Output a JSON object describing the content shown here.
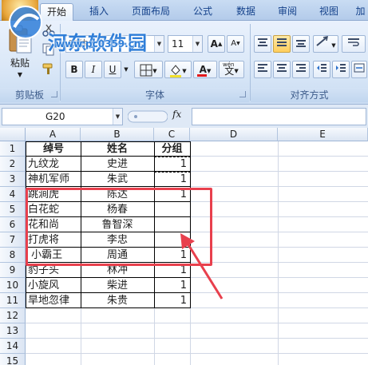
{
  "ribbon": {
    "tabs": [
      {
        "label": "开始"
      },
      {
        "label": "插入"
      },
      {
        "label": "页面布局"
      },
      {
        "label": "公式"
      },
      {
        "label": "数据"
      },
      {
        "label": "审阅"
      },
      {
        "label": "视图"
      },
      {
        "label": "加"
      }
    ],
    "watermark": {
      "title": "河东软件园",
      "url": "www.pc0359.cn"
    },
    "clipboard": {
      "paste_label": "粘贴",
      "group_label": "剪贴板"
    },
    "font": {
      "name": "宋体",
      "size": "11",
      "grow_label": "A",
      "shrink_label": "A",
      "bold": "B",
      "italic": "I",
      "underline": "U",
      "font_color_letter": "A",
      "wen_label": "文",
      "group_label": "字体",
      "fill_color": "#f2e02c",
      "font_color": "#e31a1c"
    },
    "alignment": {
      "group_label": "对齐方式"
    }
  },
  "formula_bar": {
    "name_box": "G20",
    "fx_label": "fx",
    "formula": ""
  },
  "sheet": {
    "columns": [
      "A",
      "B",
      "C",
      "D",
      "E"
    ],
    "rows": [
      {
        "n": "1",
        "a": "绰号",
        "b": "姓名",
        "c": "分组"
      },
      {
        "n": "2",
        "a": "九纹龙",
        "b": "史进",
        "c": "1"
      },
      {
        "n": "3",
        "a": "神机军师",
        "b": "朱武",
        "c": "1"
      },
      {
        "n": "4",
        "a": "跳涧虎",
        "b": "陈达",
        "c": "1"
      },
      {
        "n": "5",
        "a": "白花蛇",
        "b": "杨春",
        "c": ""
      },
      {
        "n": "6",
        "a": "花和尚",
        "b": "鲁智深",
        "c": ""
      },
      {
        "n": "7",
        "a": "打虎将",
        "b": "李忠",
        "c": ""
      },
      {
        "n": "8",
        "a": " 小霸王",
        "b": "周通",
        "c": "1"
      },
      {
        "n": "9",
        "a": "豹子头",
        "b": "林冲",
        "c": "1"
      },
      {
        "n": "10",
        "a": "小旋风",
        "b": "柴进",
        "c": "1"
      },
      {
        "n": "11",
        "a": "旱地忽律",
        "b": "朱贵",
        "c": "1"
      },
      {
        "n": "12",
        "a": "",
        "b": "",
        "c": ""
      },
      {
        "n": "13",
        "a": "",
        "b": "",
        "c": ""
      },
      {
        "n": "14",
        "a": "",
        "b": "",
        "c": ""
      },
      {
        "n": "15",
        "a": "",
        "b": "",
        "c": ""
      }
    ]
  },
  "annotation_color": "#e8404d"
}
